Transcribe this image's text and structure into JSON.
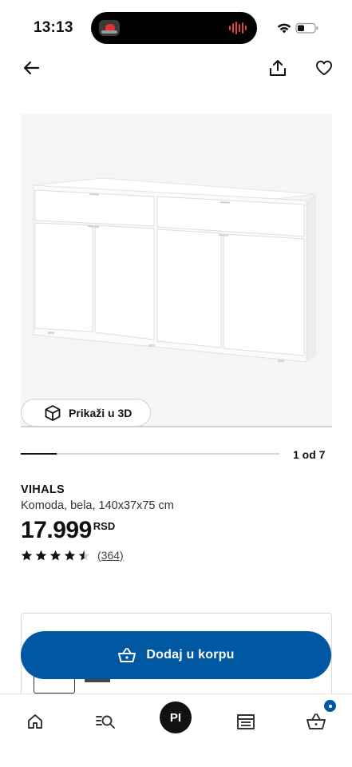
{
  "status_bar": {
    "time": "13:13",
    "icons": [
      "music-app-icon",
      "audio-wave-icon",
      "wifi-icon",
      "battery-icon"
    ]
  },
  "header": {
    "icons": [
      "back-arrow-icon",
      "share-icon",
      "heart-icon"
    ]
  },
  "gallery": {
    "view_3d_label": "Prikaži u 3D",
    "view_3d_icon": "cube-icon",
    "page_label": "1 od 7",
    "progress_fraction": 0.14
  },
  "product": {
    "name": "VIHALS",
    "description": "Komoda, bela, 140x37x75 cm",
    "price": "17.999",
    "currency": "RSD",
    "rating": 4.5,
    "rating_max": 5,
    "review_count": "(364)"
  },
  "cart_button": {
    "label": "Dodaj u korpu",
    "icon": "basket-icon"
  },
  "bottom_nav": {
    "items": [
      "home-icon",
      "search-icon",
      "profile-avatar",
      "store-icon",
      "cart-icon"
    ],
    "avatar_initials": "PI"
  },
  "colors": {
    "brand_blue": "#0058a3",
    "text": "#111111"
  }
}
